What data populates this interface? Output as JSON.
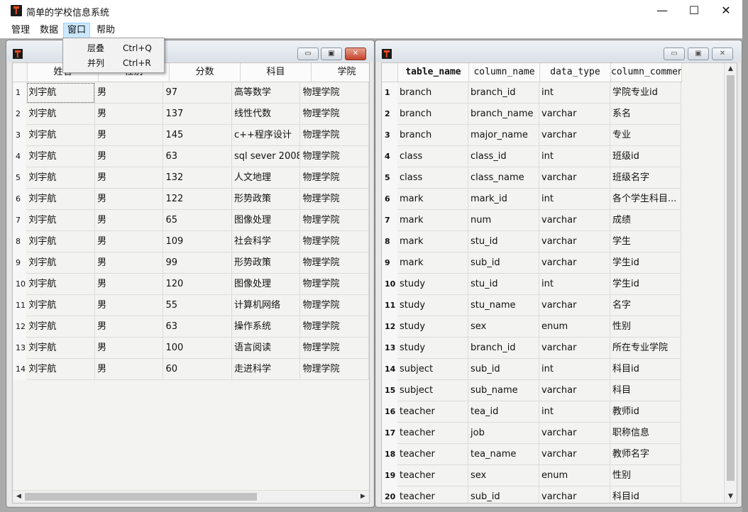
{
  "window": {
    "title": "简单的学校信息系统",
    "minimize": "—",
    "maximize": "☐",
    "close": "✕"
  },
  "menu": {
    "items": [
      "管理",
      "数据",
      "窗口",
      "帮助"
    ]
  },
  "dropdown": {
    "items": [
      {
        "label": "层叠",
        "shortcut": "Ctrl+Q"
      },
      {
        "label": "并列",
        "shortcut": "Ctrl+R"
      }
    ]
  },
  "left_table": {
    "headers": [
      "姓名",
      "性别",
      "分数",
      "科目",
      "学院"
    ],
    "rows": [
      [
        "1",
        "刘宇航",
        "男",
        "97",
        "高等数学",
        "物理学院"
      ],
      [
        "2",
        "刘宇航",
        "男",
        "137",
        "线性代数",
        "物理学院"
      ],
      [
        "3",
        "刘宇航",
        "男",
        "145",
        "c++程序设计",
        "物理学院"
      ],
      [
        "4",
        "刘宇航",
        "男",
        "63",
        "sql sever 2008",
        "物理学院"
      ],
      [
        "5",
        "刘宇航",
        "男",
        "132",
        "人文地理",
        "物理学院"
      ],
      [
        "6",
        "刘宇航",
        "男",
        "122",
        "形势政策",
        "物理学院"
      ],
      [
        "7",
        "刘宇航",
        "男",
        "65",
        "图像处理",
        "物理学院"
      ],
      [
        "8",
        "刘宇航",
        "男",
        "109",
        "社会科学",
        "物理学院"
      ],
      [
        "9",
        "刘宇航",
        "男",
        "99",
        "形势政策",
        "物理学院"
      ],
      [
        "10",
        "刘宇航",
        "男",
        "120",
        "图像处理",
        "物理学院"
      ],
      [
        "11",
        "刘宇航",
        "男",
        "55",
        "计算机网络",
        "物理学院"
      ],
      [
        "12",
        "刘宇航",
        "男",
        "63",
        "操作系统",
        "物理学院"
      ],
      [
        "13",
        "刘宇航",
        "男",
        "100",
        "语言阅读",
        "物理学院"
      ],
      [
        "14",
        "刘宇航",
        "男",
        "60",
        "走进科学",
        "物理学院"
      ]
    ]
  },
  "right_table": {
    "headers": [
      "table_name",
      "column_name",
      "data_type",
      "column_comment"
    ],
    "rows": [
      [
        "1",
        "branch",
        "branch_id",
        "int",
        "学院专业id"
      ],
      [
        "2",
        "branch",
        "branch_name",
        "varchar",
        "系名"
      ],
      [
        "3",
        "branch",
        "major_name",
        "varchar",
        "专业"
      ],
      [
        "4",
        "class",
        "class_id",
        "int",
        "班级id"
      ],
      [
        "5",
        "class",
        "class_name",
        "varchar",
        "班级名字"
      ],
      [
        "6",
        "mark",
        "mark_id",
        "int",
        "各个学生科目..."
      ],
      [
        "7",
        "mark",
        "num",
        "varchar",
        "成绩"
      ],
      [
        "8",
        "mark",
        "stu_id",
        "varchar",
        "学生"
      ],
      [
        "9",
        "mark",
        "sub_id",
        "varchar",
        "学生id"
      ],
      [
        "10",
        "study",
        "stu_id",
        "int",
        "学生id"
      ],
      [
        "11",
        "study",
        "stu_name",
        "varchar",
        "名字"
      ],
      [
        "12",
        "study",
        "sex",
        "enum",
        "性别"
      ],
      [
        "13",
        "study",
        "branch_id",
        "varchar",
        "所在专业学院"
      ],
      [
        "14",
        "subject",
        "sub_id",
        "int",
        "科目id"
      ],
      [
        "15",
        "subject",
        "sub_name",
        "varchar",
        "科目"
      ],
      [
        "16",
        "teacher",
        "tea_id",
        "int",
        "教师id"
      ],
      [
        "17",
        "teacher",
        "job",
        "varchar",
        "职称信息"
      ],
      [
        "18",
        "teacher",
        "tea_name",
        "varchar",
        "教师名字"
      ],
      [
        "19",
        "teacher",
        "sex",
        "enum",
        "性别"
      ],
      [
        "20",
        "teacher",
        "sub_id",
        "varchar",
        "科目id"
      ]
    ]
  }
}
